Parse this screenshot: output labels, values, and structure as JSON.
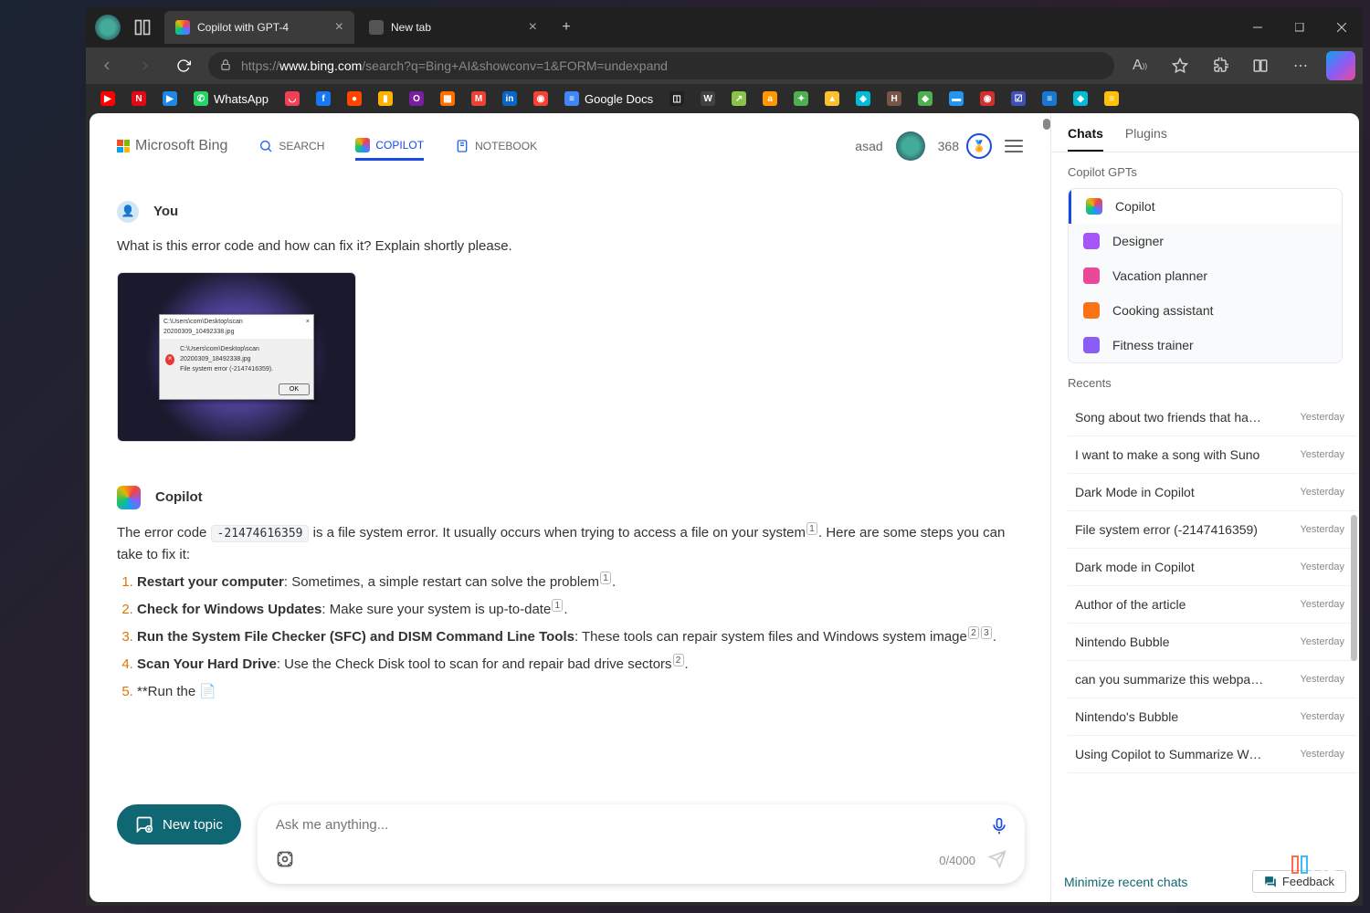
{
  "browser": {
    "tabs": [
      {
        "title": "Copilot with GPT-4",
        "active": true
      },
      {
        "title": "New tab",
        "active": false
      }
    ],
    "url_domain": "www.bing.com",
    "url_prefix": "https://",
    "url_path": "/search?q=Bing+AI&showconv=1&FORM=undexpand"
  },
  "bing_header": {
    "logo": "Microsoft Bing",
    "tabs": {
      "search": "SEARCH",
      "copilot": "COPILOT",
      "notebook": "NOTEBOOK"
    },
    "username": "asad",
    "points": "368"
  },
  "chat": {
    "you_label": "You",
    "user_message": "What is this error code and how can fix it? Explain shortly please.",
    "thumbnail": {
      "dialog_title": "C:\\Users\\com\\Desktop\\scan 20200309_10492338.jpg",
      "dialog_path": "C:\\Users\\com\\Desktop\\scan 20200309_18492338.jpg",
      "dialog_error": "File system error (-2147416359).",
      "dialog_ok": "OK"
    },
    "copilot_label": "Copilot",
    "answer_prefix": "The error code ",
    "error_code": "-21474616359",
    "answer_mid": " is a file system error. It usually occurs when trying to access a file on your system",
    "answer_suffix": ". Here are some steps you can take to fix it:",
    "steps": [
      {
        "bold": "Restart your computer",
        "rest": ": Sometimes, a simple restart can solve the problem",
        "cites": [
          "1"
        ],
        "tail": "."
      },
      {
        "bold": "Check for Windows Updates",
        "rest": ": Make sure your system is up-to-date",
        "cites": [
          "1"
        ],
        "tail": "."
      },
      {
        "bold": "Run the System File Checker (SFC) and DISM Command Line Tools",
        "rest": ": These tools can repair system files and Windows system image",
        "cites": [
          "2",
          "3"
        ],
        "tail": "."
      },
      {
        "bold": "Scan Your Hard Drive",
        "rest": ": Use the Check Disk tool to scan for and repair bad drive sectors",
        "cites": [
          "2"
        ],
        "tail": "."
      },
      {
        "bold": "",
        "rest": "**Run the ",
        "cites": [],
        "tail": "📄"
      }
    ]
  },
  "composer": {
    "new_topic": "New topic",
    "placeholder": "Ask me anything...",
    "counter": "0/4000"
  },
  "sidebar": {
    "tabs": {
      "chats": "Chats",
      "plugins": "Plugins"
    },
    "gpts_label": "Copilot GPTs",
    "gpts": [
      {
        "name": "Copilot",
        "color": "conic-gradient(from 180deg,#0ea5e9,#22c55e,#eab308,#ef4444,#8b5cf6,#0ea5e9)",
        "active": true
      },
      {
        "name": "Designer",
        "color": "#a855f7"
      },
      {
        "name": "Vacation planner",
        "color": "#ec4899"
      },
      {
        "name": "Cooking assistant",
        "color": "#f97316"
      },
      {
        "name": "Fitness trainer",
        "color": "#8b5cf6"
      }
    ],
    "recents_label": "Recents",
    "recents": [
      {
        "title": "Song about two friends that haven't se",
        "date": "Yesterday"
      },
      {
        "title": "I want to make a song with Suno",
        "date": "Yesterday"
      },
      {
        "title": "Dark Mode in Copilot",
        "date": "Yesterday"
      },
      {
        "title": "File system error (-2147416359)",
        "date": "Yesterday"
      },
      {
        "title": "Dark mode in Copilot",
        "date": "Yesterday"
      },
      {
        "title": "Author of the article",
        "date": "Yesterday"
      },
      {
        "title": "Nintendo Bubble",
        "date": "Yesterday"
      },
      {
        "title": "can you summarize this webpage for m",
        "date": "Yesterday"
      },
      {
        "title": "Nintendo's Bubble",
        "date": "Yesterday"
      },
      {
        "title": "Using Copilot to Summarize Web Pag",
        "date": "Yesterday"
      }
    ],
    "minimize": "Minimize recent chats",
    "feedback": "Feedback"
  },
  "bookmarks": [
    {
      "bg": "#ff0000",
      "txt": "▶"
    },
    {
      "bg": "#e50914",
      "txt": "N"
    },
    {
      "bg": "#1e88e5",
      "txt": "▶"
    },
    {
      "bg": "#25d366",
      "txt": "✆",
      "label": "WhatsApp"
    },
    {
      "bg": "#ef4056",
      "txt": "◡"
    },
    {
      "bg": "#1877f2",
      "txt": "f"
    },
    {
      "bg": "#ff4500",
      "txt": "●"
    },
    {
      "bg": "#ffb300",
      "txt": "▮"
    },
    {
      "bg": "#7b1fa2",
      "txt": "O"
    },
    {
      "bg": "#ff6f00",
      "txt": "▦"
    },
    {
      "bg": "#ea4335",
      "txt": "M"
    },
    {
      "bg": "#0a66c2",
      "txt": "in"
    },
    {
      "bg": "#f44336",
      "txt": "◉"
    },
    {
      "bg": "#4285f4",
      "txt": "≡",
      "label": "Google Docs"
    },
    {
      "bg": "#212121",
      "txt": "◫"
    },
    {
      "bg": "#424242",
      "txt": "W"
    },
    {
      "bg": "#8bc34a",
      "txt": "↗"
    },
    {
      "bg": "#ff9800",
      "txt": "a"
    },
    {
      "bg": "#4caf50",
      "txt": "✦"
    },
    {
      "bg": "#fbc02d",
      "txt": "▲"
    },
    {
      "bg": "#00bcd4",
      "txt": "◈"
    },
    {
      "bg": "#795548",
      "txt": "H"
    },
    {
      "bg": "#4caf50",
      "txt": "◆"
    },
    {
      "bg": "#2196f3",
      "txt": "▬"
    },
    {
      "bg": "#d32f2f",
      "txt": "◉"
    },
    {
      "bg": "#3f51b5",
      "txt": "☑"
    },
    {
      "bg": "#1976d2",
      "txt": "≡"
    },
    {
      "bg": "#00bcd4",
      "txt": "◆"
    },
    {
      "bg": "#ffc107",
      "txt": "≡"
    }
  ]
}
